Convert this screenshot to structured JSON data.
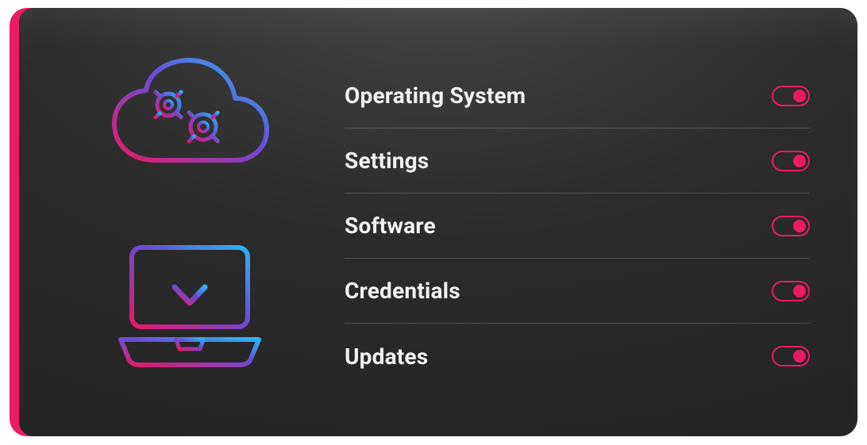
{
  "colors": {
    "accent": "#ea1a64",
    "gradient_start": "#e61a64",
    "gradient_mid": "#6b4bd6",
    "gradient_end": "#28b6f6"
  },
  "icons": {
    "cloud_gears": "cloud-gears-icon",
    "laptop_download": "laptop-download-icon"
  },
  "settings": [
    {
      "label": "Operating System",
      "on": true
    },
    {
      "label": "Settings",
      "on": true
    },
    {
      "label": "Software",
      "on": true
    },
    {
      "label": "Credentials",
      "on": true
    },
    {
      "label": "Updates",
      "on": true
    }
  ]
}
